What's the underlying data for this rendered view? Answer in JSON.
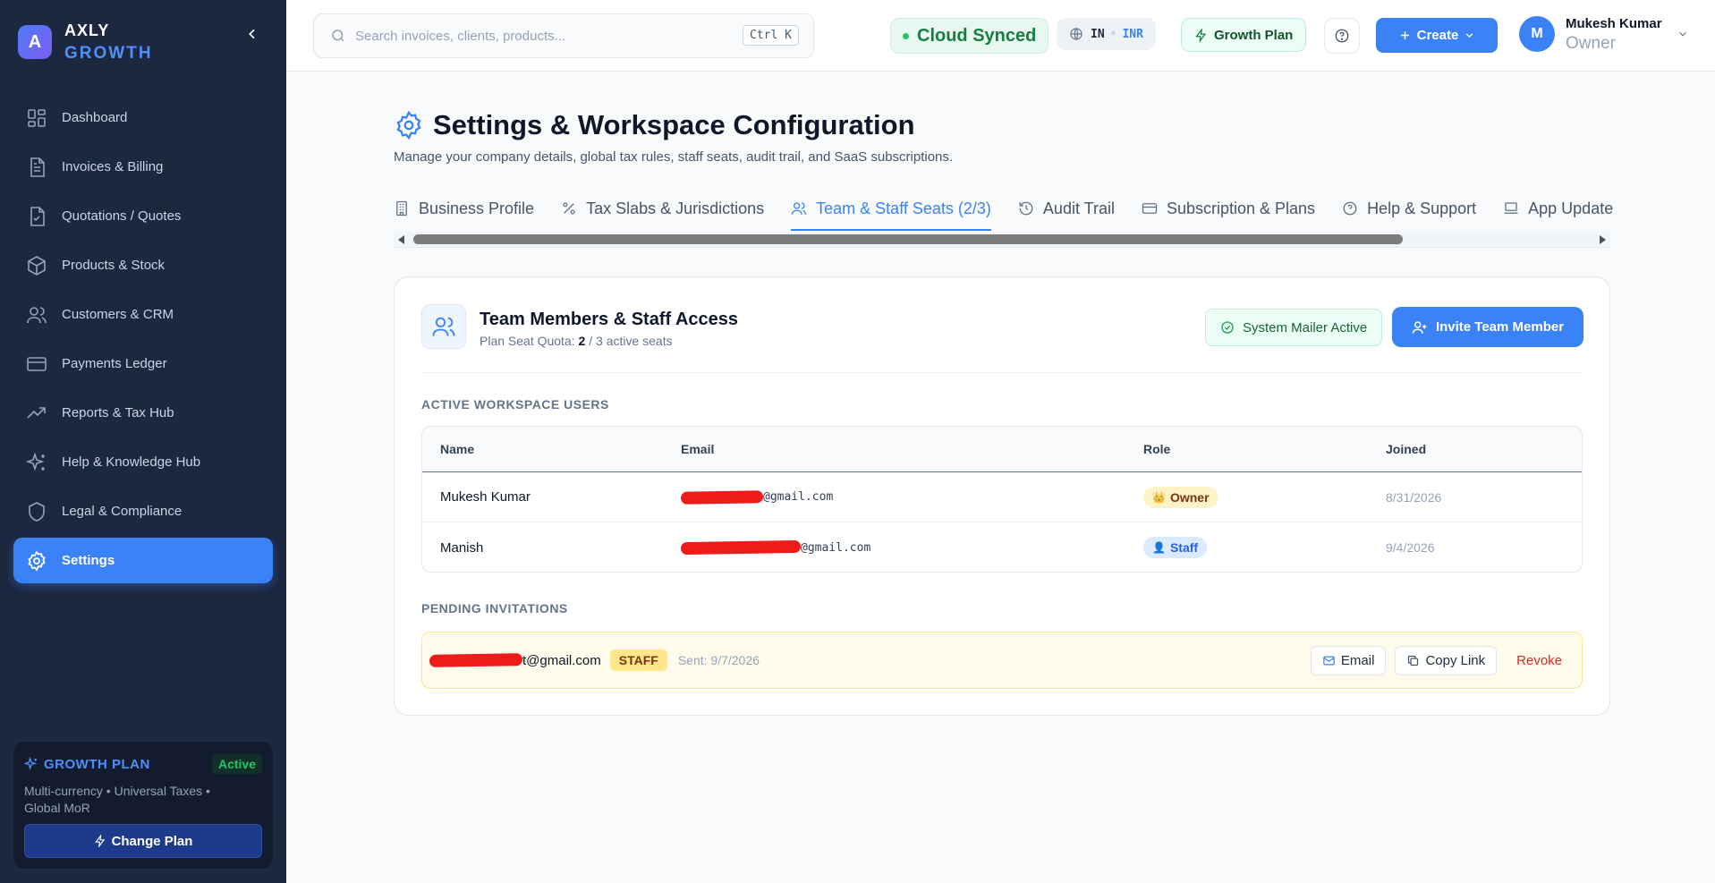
{
  "brand": {
    "logo_letter": "A",
    "name": "AXLY",
    "sub": "GROWTH"
  },
  "sidebar": {
    "items": [
      {
        "label": "Dashboard",
        "icon": "dashboard-icon"
      },
      {
        "label": "Invoices & Billing",
        "icon": "invoice-icon"
      },
      {
        "label": "Quotations / Quotes",
        "icon": "quote-icon"
      },
      {
        "label": "Products & Stock",
        "icon": "box-icon"
      },
      {
        "label": "Customers & CRM",
        "icon": "users-icon"
      },
      {
        "label": "Payments Ledger",
        "icon": "card-icon"
      },
      {
        "label": "Reports & Tax Hub",
        "icon": "trend-icon"
      },
      {
        "label": "Help & Knowledge Hub",
        "icon": "sparkle-icon"
      },
      {
        "label": "Legal & Compliance",
        "icon": "shield-icon"
      },
      {
        "label": "Settings",
        "icon": "gear-icon",
        "active": true
      }
    ],
    "plan": {
      "title": "GROWTH PLAN",
      "status": "Active",
      "desc": "Multi-currency • Universal Taxes • Global MoR",
      "button": "Change Plan"
    }
  },
  "topbar": {
    "search_placeholder": "Search invoices, clients, products...",
    "shortcut": "Ctrl K",
    "sync": "Cloud Synced",
    "country": "IN",
    "currency": "INR",
    "plan_badge": "Growth Plan",
    "create": "Create",
    "user": {
      "initial": "M",
      "name": "Mukesh Kumar",
      "role": "Owner"
    }
  },
  "page": {
    "title": "Settings & Workspace Configuration",
    "subtitle": "Manage your company details, global tax rules, staff seats, audit trail, and SaaS subscriptions."
  },
  "tabs": [
    {
      "label": "Business Profile",
      "icon": "building-icon"
    },
    {
      "label": "Tax Slabs & Jurisdictions",
      "icon": "percent-icon"
    },
    {
      "label": "Team & Staff Seats (2/3)",
      "icon": "users-icon",
      "active": true
    },
    {
      "label": "Audit Trail",
      "icon": "history-icon"
    },
    {
      "label": "Subscription & Plans",
      "icon": "card-icon"
    },
    {
      "label": "Help & Support",
      "icon": "help-icon"
    },
    {
      "label": "App Update",
      "icon": "laptop-icon"
    }
  ],
  "team": {
    "title": "Team Members & Staff Access",
    "quota_prefix": "Plan Seat Quota: ",
    "quota_used": "2",
    "quota_suffix": " / 3 active seats",
    "mailer": "System Mailer Active",
    "invite": "Invite Team Member",
    "active_label": "ACTIVE WORKSPACE USERS",
    "columns": {
      "name": "Name",
      "email": "Email",
      "role": "Role",
      "joined": "Joined"
    },
    "users": [
      {
        "name": "Mukesh Kumar",
        "email_domain": "@gmail.com",
        "role": "Owner",
        "role_glyph": "👑",
        "joined": "8/31/2026"
      },
      {
        "name": "Manish",
        "email_domain": "@gmail.com",
        "role": "Staff",
        "role_glyph": "👤",
        "joined": "9/4/2026"
      }
    ],
    "pending_label": "PENDING INVITATIONS",
    "pending": {
      "email_suffix": "t@gmail.com",
      "role": "STAFF",
      "sent": "Sent: 9/7/2026",
      "email_btn": "Email",
      "copy_btn": "Copy Link",
      "revoke": "Revoke"
    }
  },
  "colors": {
    "accent": "#3b82f6",
    "sidebar": "#1c2740",
    "success": "#15803d",
    "danger": "#dc2626"
  }
}
